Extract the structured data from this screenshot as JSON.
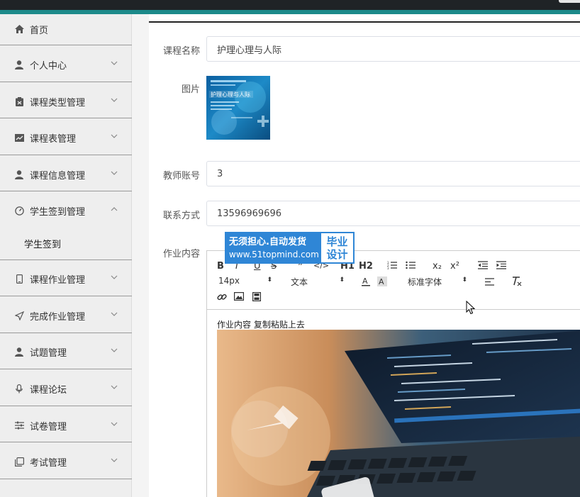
{
  "sidebar": {
    "items": [
      {
        "label": "首页",
        "icon": "home-icon"
      },
      {
        "label": "个人中心",
        "icon": "user-icon"
      },
      {
        "label": "课程类型管理",
        "icon": "clipboard-icon"
      },
      {
        "label": "课程表管理",
        "icon": "chart-icon"
      },
      {
        "label": "课程信息管理",
        "icon": "user-icon"
      },
      {
        "label": "学生签到管理",
        "icon": "dashboard-icon"
      },
      {
        "label": "课程作业管理",
        "icon": "phone-icon"
      },
      {
        "label": "完成作业管理",
        "icon": "send-icon"
      },
      {
        "label": "试题管理",
        "icon": "user-icon"
      },
      {
        "label": "课程论坛",
        "icon": "mic-icon"
      },
      {
        "label": "试卷管理",
        "icon": "sliders-icon"
      },
      {
        "label": "考试管理",
        "icon": "copy-icon"
      }
    ],
    "subitem": "学生签到"
  },
  "form": {
    "course_name_label": "课程名称",
    "course_name_value": "护理心理与人际",
    "image_label": "图片",
    "teacher_label": "教师账号",
    "teacher_value": "3",
    "contact_label": "联系方式",
    "contact_value": "13596969696",
    "content_label": "作业内容"
  },
  "thumbnail": {
    "title": "护理心理与人际"
  },
  "watermark": {
    "line1": "无须担心.自动发货",
    "line2": "www.51topmind.com",
    "right1": "毕业",
    "right2": "设计"
  },
  "editor": {
    "toolbar": {
      "bold": "B",
      "italic": "I",
      "underline": "U",
      "strike": "S",
      "quote": "❞",
      "code": "</>",
      "h1": "H1",
      "h2": "H2",
      "sub": "x₂",
      "sup": "x²",
      "size": "14px",
      "type": "文本",
      "font": "标准字体"
    },
    "content_text": "作业内容 复制粘贴上去"
  },
  "colors": {
    "teal": "#1c8a8a",
    "watermark_blue": "#2f86d6",
    "sidebar_bg": "#eeeeee"
  }
}
